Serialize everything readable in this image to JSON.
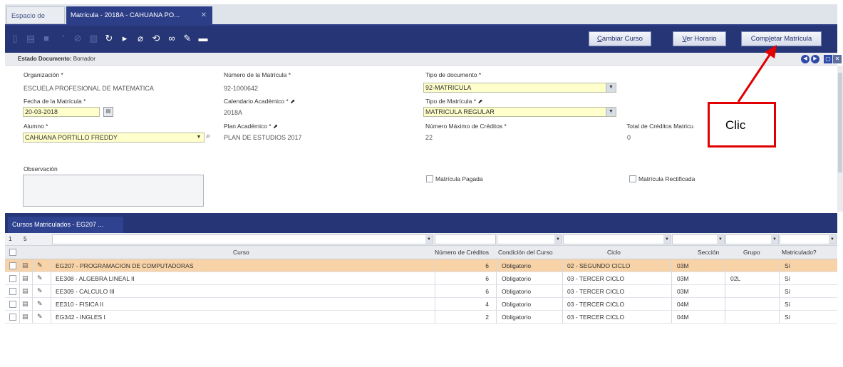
{
  "tabs": {
    "workspace": "Espacio de trabajo",
    "matricula": "Matrícula - 2018A - CAHUANA PO...",
    "close_glyph": "✕"
  },
  "toolbar": {
    "buttons": {
      "cambiar_curso": {
        "pre": "",
        "accel": "C",
        "rest": "ambiar Curso"
      },
      "ver_horario": {
        "pre": "",
        "accel": "V",
        "rest": "er Horario"
      },
      "completar_matricula": {
        "pre": "Comp",
        "accel": "l",
        "rest": "etar Matrícula"
      }
    },
    "icons": [
      "new-icon",
      "copy-icon",
      "save-icon",
      "undo-icon",
      "cancel-icon",
      "delete-icon",
      "refresh-icon",
      "export-icon",
      "attach-icon",
      "help-icon",
      "link-icon",
      "report-icon",
      "print-icon"
    ]
  },
  "status": {
    "label": "Estado Documento:",
    "value": "Borrador"
  },
  "form": {
    "organizacion": {
      "label": "Organización *",
      "value": "ESCUELA PROFESIONAL DE MATEMATICA"
    },
    "numero_matricula": {
      "label": "Número de la Matrícula *",
      "value": "92-1000642"
    },
    "tipo_documento": {
      "label": "Tipo de documento *",
      "value": "92-MATRICULA"
    },
    "fecha_matricula": {
      "label": "Fecha de la Matrícula *",
      "value": "20-03-2018"
    },
    "calendario": {
      "label": "Calendario Académico * ⬈",
      "value": "2018A"
    },
    "tipo_matricula": {
      "label": "Tipo de Matrícula * ⬈",
      "value": "MATRICULA REGULAR"
    },
    "alumno": {
      "label": "Alumno *",
      "value": "CAHUANA PORTILLO FREDDY"
    },
    "plan_academico": {
      "label": "Plan Académico * ⬈",
      "value": "PLAN DE ESTUDIOS 2017"
    },
    "max_creditos": {
      "label": "Número Máximo de Créditos *",
      "value": "22"
    },
    "total_creditos": {
      "label": "Total de Créditos Matricu",
      "value": "0"
    },
    "observacion": {
      "label": "Observación"
    },
    "matricula_pagada": {
      "label": "Matrícula Pagada"
    },
    "matricula_rectificada": {
      "label": "Matrícula Rectificada"
    }
  },
  "grid": {
    "title": "Cursos Matriculados - EG207 ...",
    "pager": {
      "page": "1",
      "count": "5"
    },
    "columns": [
      "Curso",
      "Número de Créditos",
      "Condición del Curso",
      "Ciclo",
      "Sección",
      "Grupo",
      "Matriculado?"
    ],
    "rows": [
      {
        "curso": "EG207 - PROGRAMACION DE COMPUTADORAS",
        "creditos": "6",
        "condicion": "Obligatorio",
        "ciclo": "02 - SEGUNDO CICLO",
        "seccion": "03M",
        "grupo": "",
        "matriculado": "Sí"
      },
      {
        "curso": "EE308 - ALGEBRA LINEAL II",
        "creditos": "6",
        "condicion": "Obligatorio",
        "ciclo": "03 - TERCER CICLO",
        "seccion": "03M",
        "grupo": "02L",
        "matriculado": "Sí"
      },
      {
        "curso": "EE309 - CALCULO III",
        "creditos": "6",
        "condicion": "Obligatorio",
        "ciclo": "03 - TERCER CICLO",
        "seccion": "03M",
        "grupo": "",
        "matriculado": "Sí"
      },
      {
        "curso": "EE310 - FISICA II",
        "creditos": "4",
        "condicion": "Obligatorio",
        "ciclo": "03 - TERCER CICLO",
        "seccion": "04M",
        "grupo": "",
        "matriculado": "Sí"
      },
      {
        "curso": "EG342 - INGLES I",
        "creditos": "2",
        "condicion": "Obligatorio",
        "ciclo": "03 - TERCER CICLO",
        "seccion": "04M",
        "grupo": "",
        "matriculado": "Sí"
      }
    ]
  },
  "annotation": {
    "text": "Clic",
    "color": "#e00000"
  },
  "colors": {
    "toolbar": "#263575",
    "selected_row": "#f8d3a8",
    "mandatory_field": "#ffffcc"
  }
}
